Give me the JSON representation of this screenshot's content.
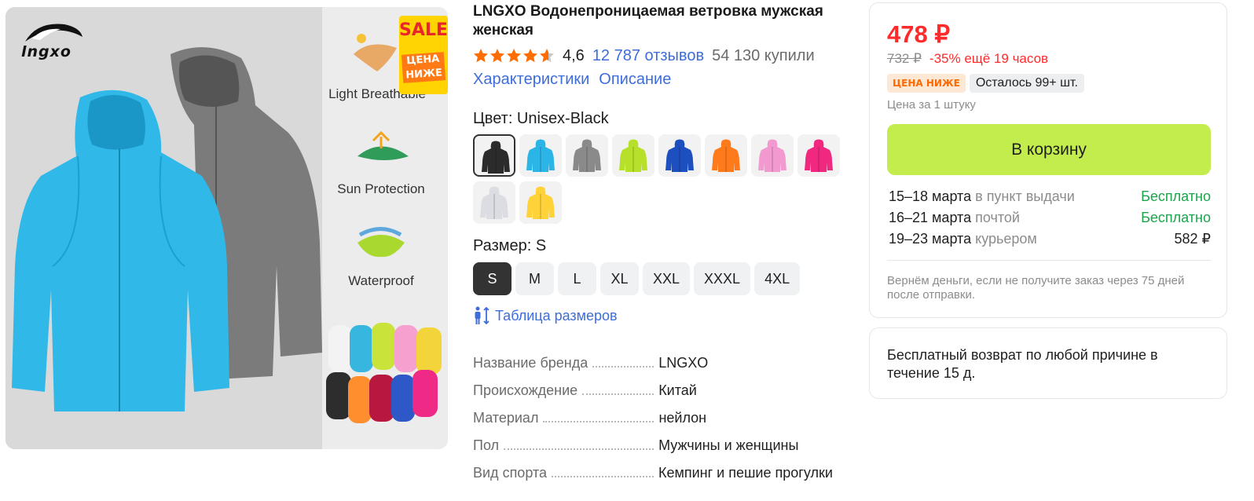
{
  "gallery": {
    "brand_logo_text": "lngxo",
    "sale_text": "SALE",
    "price_lower_text": "ЦЕНА НИЖЕ",
    "features": [
      "Light Breathable",
      "Sun Protection",
      "Waterproof"
    ]
  },
  "product": {
    "title": "LNGXO Водонепроницаемая ветровка мужская женская",
    "rating": "4,6",
    "rating_stars": 4.6,
    "reviews": "12 787 отзывов",
    "bought": "54 130 купили",
    "links": [
      "Характеристики",
      "Описание"
    ],
    "color_label": "Цвет: Unisex-Black",
    "colors": [
      "#2b2b2b",
      "#2bb5e6",
      "#8a8a8a",
      "#b7e02a",
      "#1e4fbf",
      "#ff7a1a",
      "#f29ad0",
      "#f0287f",
      "#dcdde2",
      "#ffd23a"
    ],
    "selected_color_index": 0,
    "size_label": "Размер: S",
    "sizes": [
      "S",
      "M",
      "L",
      "XL",
      "XXL",
      "XXXL",
      "4XL"
    ],
    "selected_size_index": 0,
    "size_table_label": "Таблица размеров",
    "specs": [
      {
        "key": "Название бренда",
        "value": "LNGXO"
      },
      {
        "key": "Происхождение",
        "value": "Китай"
      },
      {
        "key": "Материал",
        "value": "нейлон"
      },
      {
        "key": "Пол",
        "value": "Мужчины и женщины"
      },
      {
        "key": "Вид спорта",
        "value": "Кемпинг и пешие прогулки"
      }
    ]
  },
  "buy": {
    "price": "478 ₽",
    "old_price": "732 ₽",
    "discount": "-35% ещё 19 часов",
    "badge_low": "ЦЕНА НИЖЕ",
    "stock": "Осталось 99+ шт.",
    "unit_price": "Цена за 1 штуку",
    "cart_button": "В корзину",
    "delivery": [
      {
        "date": "15–18 марта",
        "method": "в пункт выдачи",
        "cost": "Бесплатно"
      },
      {
        "date": "16–21 марта",
        "method": "почтой",
        "cost": "Бесплатно"
      },
      {
        "date": "19–23 марта",
        "method": "курьером",
        "cost": "582 ₽"
      }
    ],
    "refund_note": "Вернём деньги, если не получите заказ через 75 дней после отправки.",
    "return_policy": "Бесплатный возврат по любой причине в течение 15 д."
  },
  "colors": {
    "price_red": "#ff2a2a",
    "link_blue": "#3d6ddb",
    "cart_green": "#c2ed4c",
    "free_green": "#1ca44b"
  }
}
